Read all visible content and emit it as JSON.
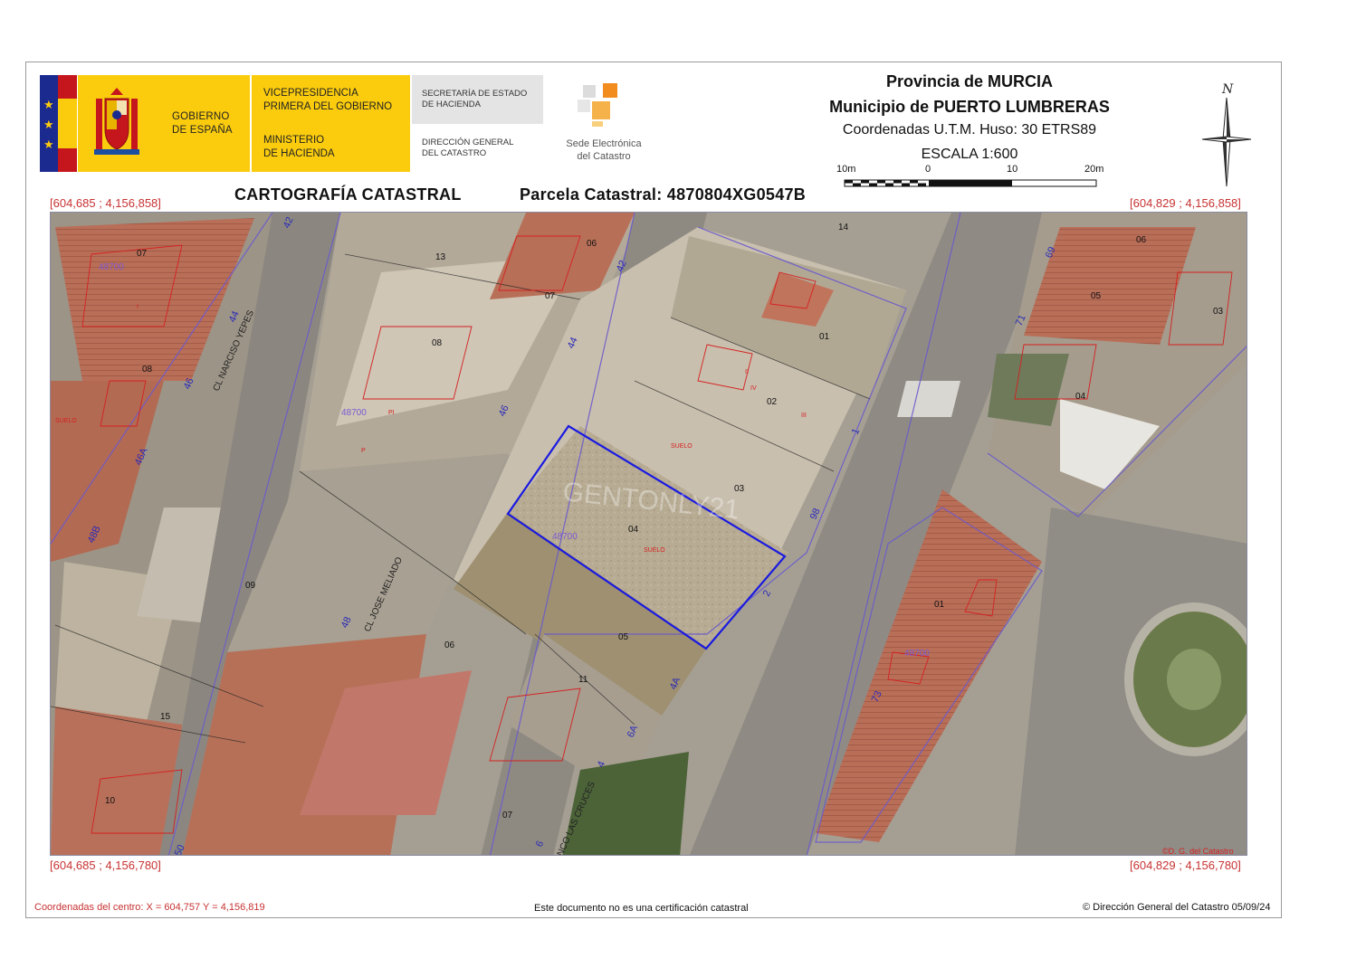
{
  "header": {
    "gobierno": [
      "GOBIERNO",
      "DE ESPAÑA"
    ],
    "vicepresidencia": [
      "VICEPRESIDENCIA",
      "PRIMERA DEL GOBIERNO"
    ],
    "ministerio": [
      "MINISTERIO",
      "DE HACIENDA"
    ],
    "secretaria": [
      "SECRETARÍA DE ESTADO",
      "DE HACIENDA"
    ],
    "direccion": [
      "DIRECCIÓN GENERAL",
      "DEL CATASTRO"
    ],
    "sede": [
      "Sede Electrónica",
      "del Catastro"
    ],
    "provincia": "Provincia de MURCIA",
    "municipio": "Municipio de PUERTO LUMBRERAS",
    "coordenadas": "Coordenadas U.T.M. Huso: 30 ETRS89",
    "escala": "ESCALA 1:600",
    "scale_ticks": [
      "10m",
      "0",
      "10",
      "20m"
    ],
    "north": "N"
  },
  "titles": {
    "cartografia": "CARTOGRAFÍA CATASTRAL",
    "parcela": "Parcela Catastral: 4870804XG0547B"
  },
  "corners": {
    "top_left": "[604,685 ; 4,156,858]",
    "top_right": "[604,829 ; 4,156,858]",
    "bottom_left": "[604,685 ; 4,156,780]",
    "bottom_right": "[604,829 ; 4,156,780]"
  },
  "map": {
    "streets": [
      "CL NARCISO YEPES",
      "CL JOSE MELIADO",
      "NCO LAS CRUCES"
    ],
    "parcel_numbers": [
      "07",
      "13",
      "06",
      "07",
      "08",
      "08",
      "14",
      "01",
      "02",
      "03",
      "04",
      "05",
      "11",
      "06",
      "09",
      "15",
      "10",
      "07",
      "05",
      "06",
      "04",
      "03",
      "01"
    ],
    "block_ids": [
      "48700",
      "48700",
      "48700",
      "48700"
    ],
    "house_numbers": [
      "42",
      "42",
      "44",
      "46",
      "46",
      "46A",
      "48B",
      "48",
      "50",
      "6A",
      "4A",
      "2",
      "4",
      "6",
      "98",
      "69",
      "71",
      "73",
      "44",
      "1"
    ],
    "labels": [
      "SUELO",
      "SUELO",
      "SUELO",
      "I",
      "II",
      "III",
      "IV",
      "P",
      "PI"
    ],
    "watermark": "GENTONLY21",
    "credit": "©D. G. del Catastro"
  },
  "footer": {
    "centro": "Coordenadas del centro: X = 604,757 Y = 4,156,819",
    "aviso": "Este documento no es una certificación catastral",
    "copyright": "© Dirección General del Catastro 05/09/24"
  }
}
